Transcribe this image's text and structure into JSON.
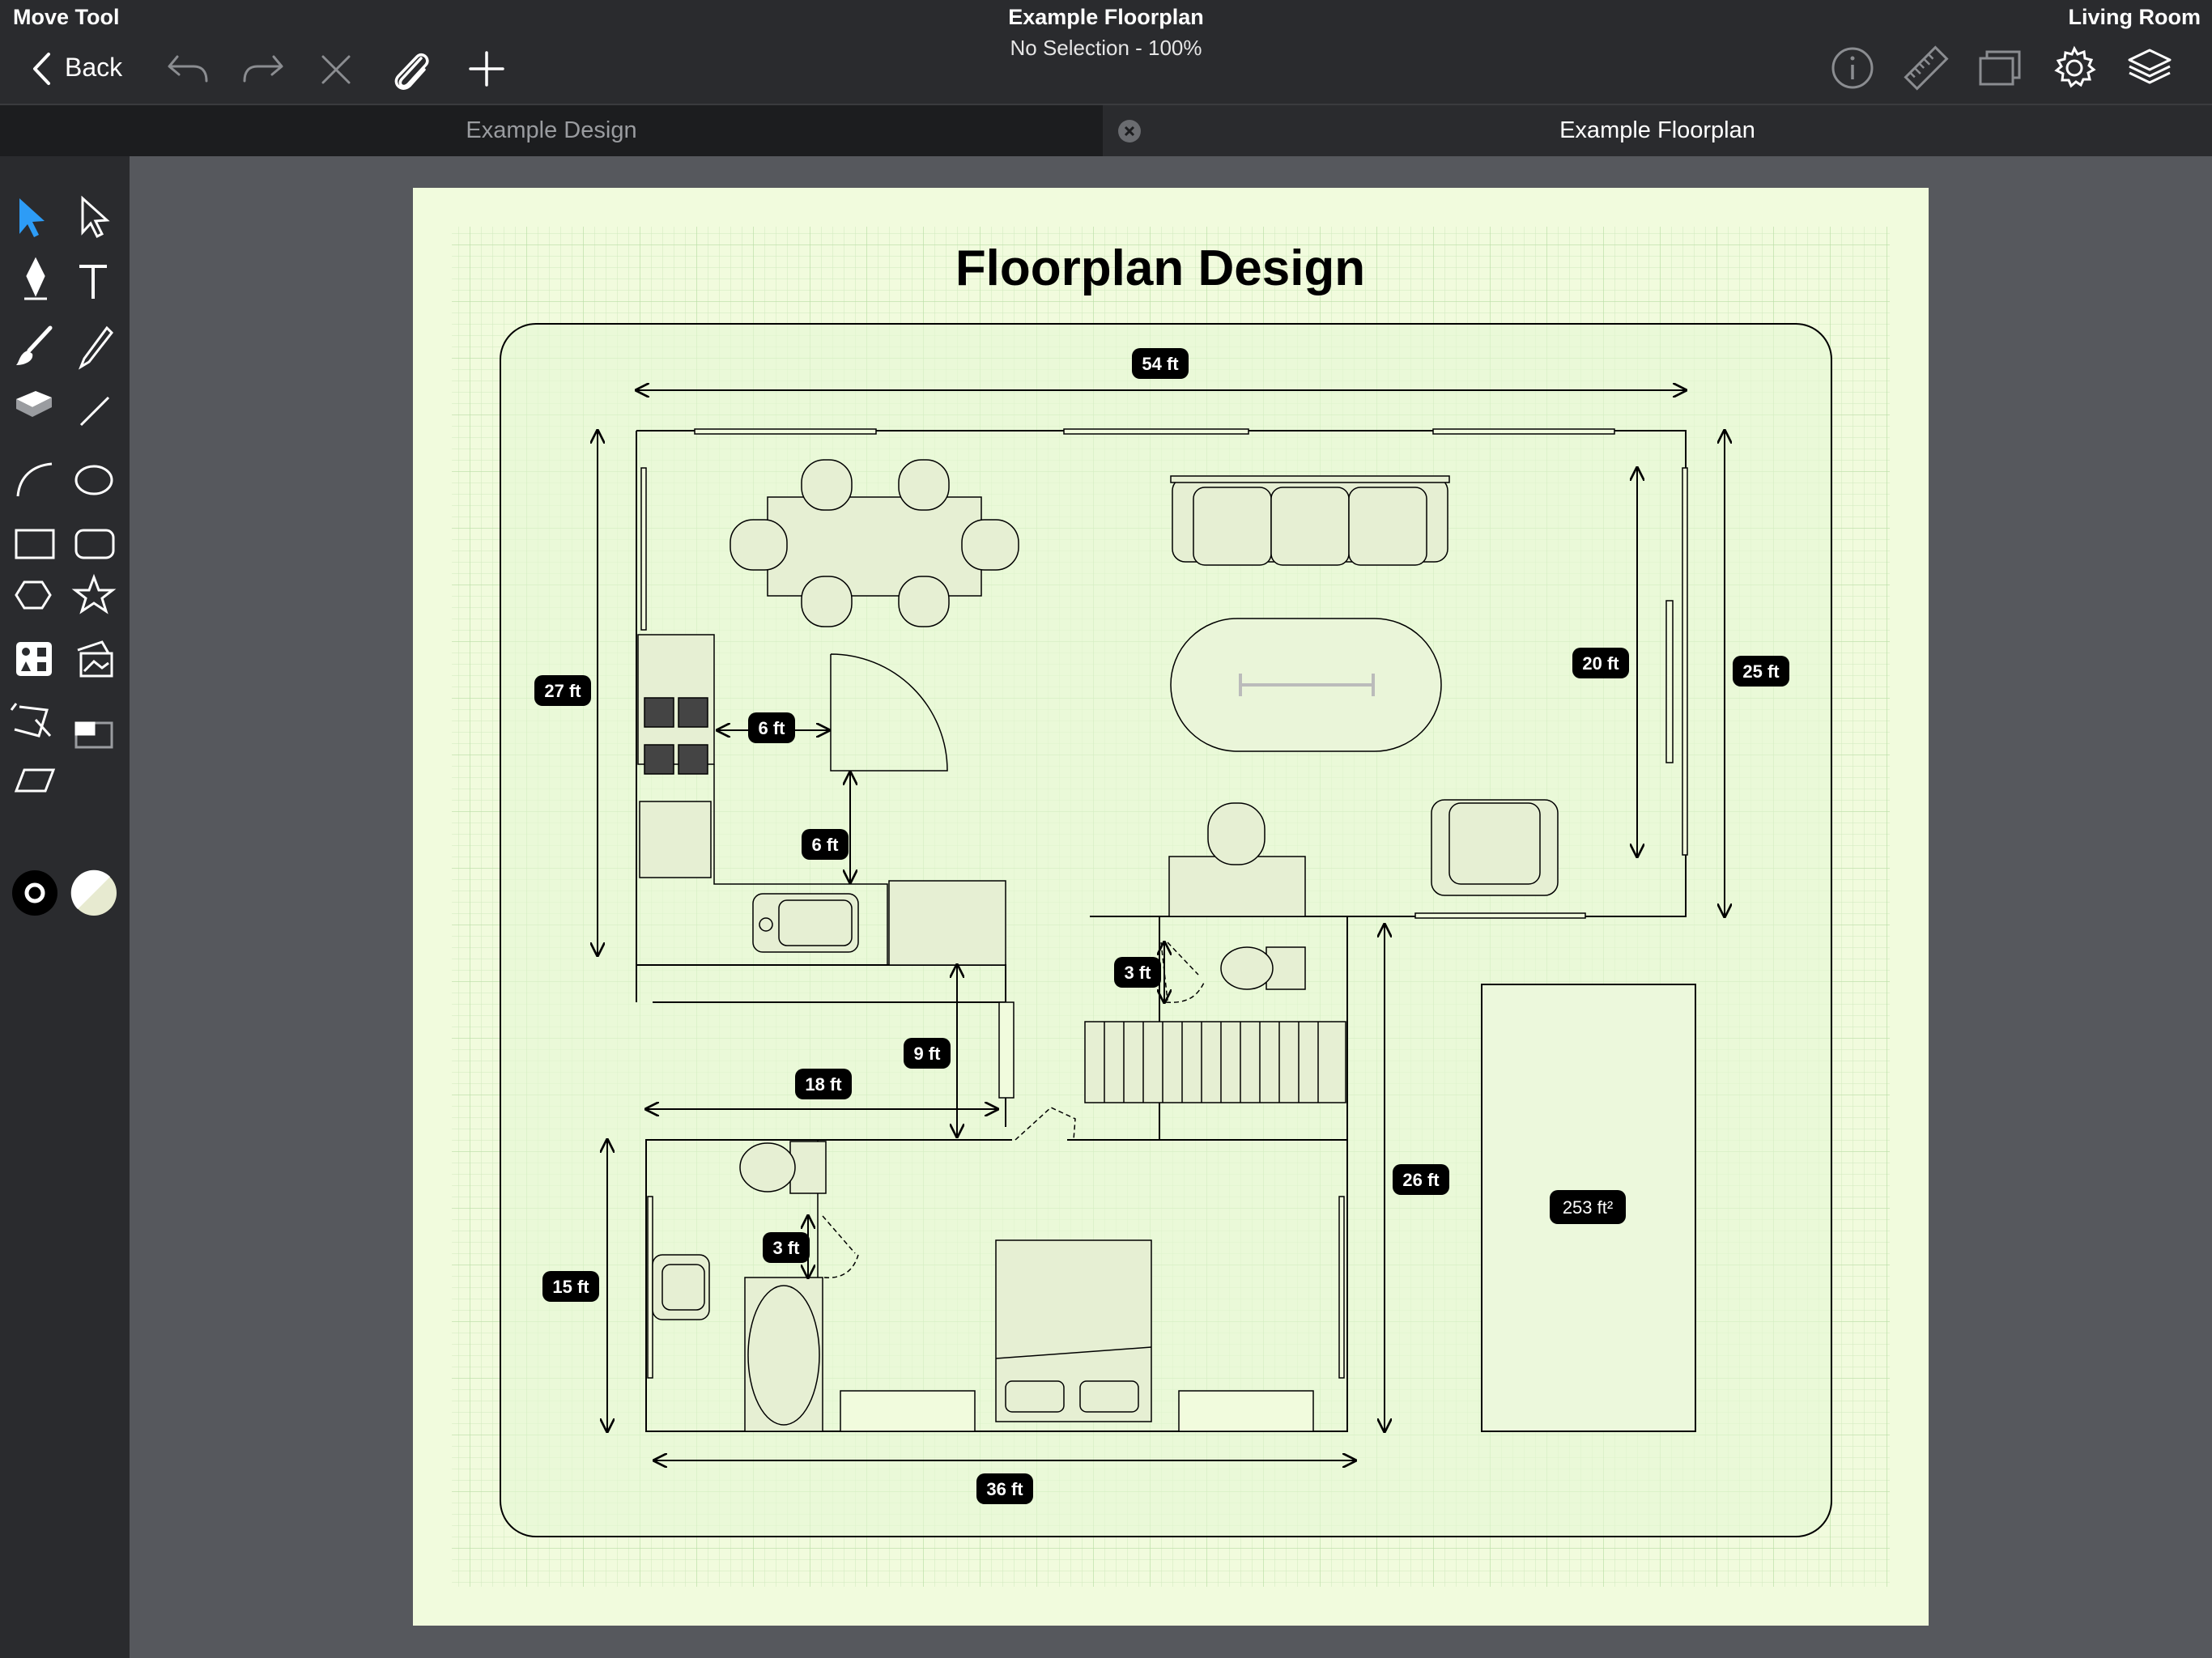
{
  "top_bar": {
    "tool_name": "Move Tool",
    "document_title": "Example Floorplan",
    "selection_status": "No Selection - 100%",
    "layer_name": "Living Room",
    "back_label": "Back",
    "left_icons": [
      "undo-icon",
      "redo-icon",
      "delete-icon",
      "attach-icon",
      "add-icon"
    ],
    "right_icons": [
      "info-icon",
      "ruler-icon",
      "canvas-icon",
      "settings-icon",
      "layers-icon"
    ]
  },
  "tabs": [
    {
      "label": "Example Design",
      "active": false
    },
    {
      "label": "Example Floorplan",
      "active": true
    }
  ],
  "tools": [
    "select-arrow",
    "direct-select",
    "pen",
    "text",
    "brush",
    "pencil",
    "eraser",
    "line",
    "arc",
    "ellipse",
    "rectangle",
    "rounded-rectangle",
    "polygon",
    "star",
    "shapes-library",
    "image",
    "transform",
    "crop",
    "skew"
  ],
  "colors": {
    "stroke": "#000000",
    "fill": "#e7ead0",
    "accent": "#2d9cf6",
    "page": "#f1fbdd",
    "grid": "#d7ebc6"
  },
  "drawing": {
    "title": "Floorplan Design",
    "dimensions": {
      "top_width": "54 ft",
      "left_height": "27 ft",
      "right_height": "25 ft",
      "living_height": "20 ft",
      "stove_to_door": "6 ft",
      "door_to_counter": "6 ft",
      "bath_door_upper": "3 ft",
      "hall_gap": "9 ft",
      "bedroom_width": "18 ft",
      "bath_door_lower": "3 ft",
      "bedroom_height": "15 ft",
      "east_height": "26 ft",
      "bottom_width": "36 ft",
      "area": "253 ft²"
    }
  }
}
